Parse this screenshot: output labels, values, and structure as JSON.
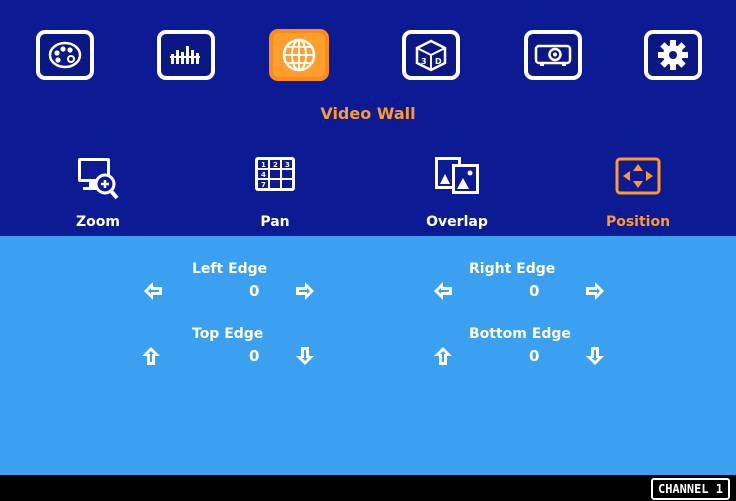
{
  "menu": {
    "tabs": [
      {
        "name": "palette",
        "icon": "palette-icon",
        "active": false
      },
      {
        "name": "equalizer",
        "icon": "equalizer-icon",
        "active": false
      },
      {
        "name": "video-wall",
        "icon": "globe-icon",
        "active": true
      },
      {
        "name": "3d",
        "icon": "3d-cube-icon",
        "active": false
      },
      {
        "name": "projector",
        "icon": "projector-icon",
        "active": false
      },
      {
        "name": "settings",
        "icon": "gear-icon",
        "active": false
      }
    ],
    "section_title": "Video Wall"
  },
  "submenu": {
    "zoom": "Zoom",
    "pan": "Pan",
    "overlap": "Overlap",
    "position": "Position",
    "active": "Position"
  },
  "position": {
    "left_edge": {
      "label": "Left Edge",
      "value": "0"
    },
    "right_edge": {
      "label": "Right Edge",
      "value": "0"
    },
    "top_edge": {
      "label": "Top Edge",
      "value": "0"
    },
    "bottom_edge": {
      "label": "Bottom Edge",
      "value": "0"
    }
  },
  "status": {
    "channel": "CHANNEL 1"
  },
  "colors": {
    "top_bg": "#0c1b93",
    "bottom_bg": "#3aa0ef",
    "accent": "#ff9a2a"
  }
}
